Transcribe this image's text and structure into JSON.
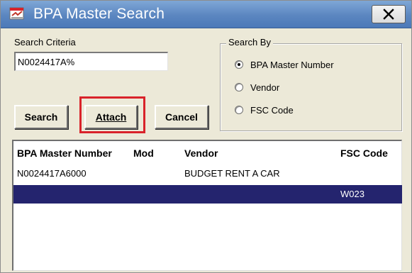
{
  "window": {
    "title": "BPA Master Search",
    "close_label": "X"
  },
  "search_criteria": {
    "label": "Search Criteria",
    "value": "N0024417A%"
  },
  "search_by": {
    "legend": "Search By",
    "options": [
      {
        "label": "BPA Master Number",
        "selected": true
      },
      {
        "label": "Vendor",
        "selected": false
      },
      {
        "label": "FSC Code",
        "selected": false
      }
    ]
  },
  "buttons": {
    "search": "Search",
    "attach": "Attach",
    "cancel": "Cancel"
  },
  "results": {
    "columns": [
      "BPA Master Number",
      "Mod",
      "Vendor",
      "FSC Code"
    ],
    "rows": [
      {
        "bpa": "N0024417A6000",
        "mod": "",
        "vendor": "BUDGET RENT A CAR",
        "fsc": "",
        "selected": false
      },
      {
        "bpa": "",
        "mod": "",
        "vendor": "",
        "fsc": "W023",
        "selected": true
      }
    ]
  },
  "colors": {
    "titlebar": "#5b86c0",
    "selection": "#24246e",
    "highlight": "#d9232a",
    "dialog_bg": "#ece9d8"
  }
}
